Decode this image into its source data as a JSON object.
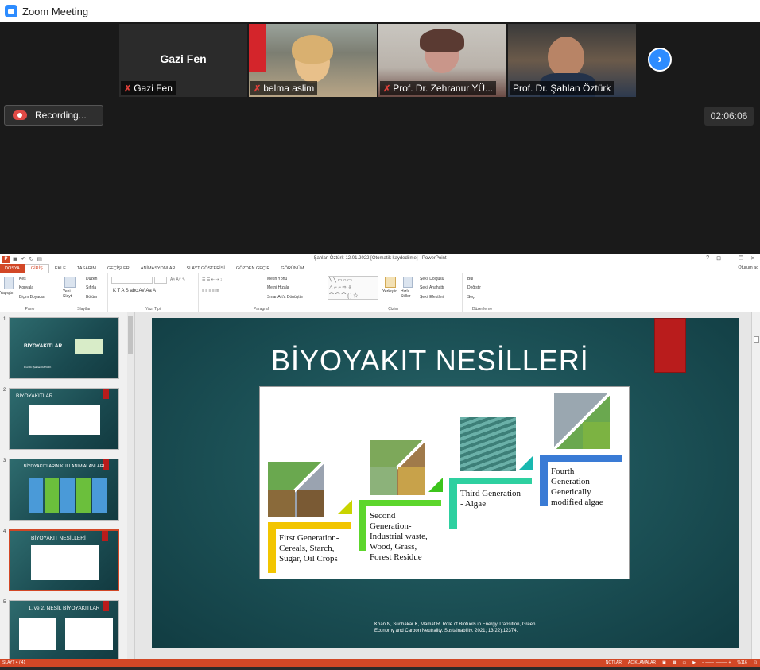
{
  "zoom": {
    "window_title": "Zoom Meeting",
    "participants": [
      {
        "name": "Gazi Fen",
        "display": "Gazi Fen",
        "video": false
      },
      {
        "name": "belma aslim",
        "video": true
      },
      {
        "name": "Prof. Dr. Zehranur YÜ...",
        "video": true
      },
      {
        "name": "Prof. Dr. Şahlan Öztürk",
        "video": true,
        "active": true
      }
    ],
    "recording_label": "Recording...",
    "timer": "02:06:06",
    "colors": {
      "accent": "#2D8CFF",
      "active_speaker": "#7ac943",
      "mute": "#e0403a"
    }
  },
  "ppt": {
    "logo": "P",
    "doc_title": "Şahlan Öztürk-12.01.2022 [Otomatik kaydedilme] - PowerPoint",
    "window_controls": [
      "?",
      "⊡",
      "–",
      "❐",
      "✕"
    ],
    "tabs": [
      "DOSYA",
      "GİRİŞ",
      "EKLE",
      "TASARIM",
      "GEÇİŞLER",
      "ANİMASYONLAR",
      "SLAYT GÖSTERİSİ",
      "GÖZDEN GEÇİR",
      "GÖRÜNÜM"
    ],
    "signin": "Oturum aç",
    "ribbon": {
      "paste": "Yapıştır",
      "cut": "Kes",
      "copy": "Kopyala",
      "format_painter": "Biçim Boyacısı",
      "group_pano": "Pano",
      "new_slide": "Yeni Slayt",
      "layout": "Düzen",
      "reset": "Sıfırla",
      "section": "Bölüm",
      "group_slaytlar": "Slaytlar",
      "group_yazi_tipi": "Yazı Tipi",
      "text_direction": "Metin Yönü",
      "align_text": "Metni Hizala",
      "smartart": "SmartArt'a Dönüştür",
      "group_paragraf": "Paragraf",
      "arrange": "Yerleştir",
      "quick_styles": "Hızlı Stiller",
      "shape_fill": "Şekil Dolgusu",
      "shape_outline": "Şekil Anahattı",
      "shape_effects": "Şekil Efektleri",
      "group_cizim": "Çizim",
      "find": "Bul",
      "replace": "Değiştir",
      "select": "Seç",
      "group_duzenleme": "Düzenleme"
    },
    "thumbnails": [
      {
        "num": "1",
        "title": "BİYOYAKITLAR",
        "subtitle": "Prof. Dr. Şahlan ÖZTÜRK"
      },
      {
        "num": "2",
        "title": "BİYOYAKITLAR"
      },
      {
        "num": "3",
        "title": "BİYOYAKITLARIN KULLANIM ALANLARI"
      },
      {
        "num": "4",
        "title": "BİYOYAKIT NESİLLERİ"
      },
      {
        "num": "5",
        "title": "1. ve 2. NESİL BİYOYAKITLAR"
      }
    ],
    "slide": {
      "title": "BİYOYAKIT NESİLLERİ",
      "steps": [
        {
          "label": "First Generation-\nCereals, Starch,\nSugar, Oil Crops",
          "color": "#f2c500"
        },
        {
          "label": "Second\nGeneration-\nIndustrial waste,\nWood, Grass,\nForest Residue",
          "color": "#5dd62c"
        },
        {
          "label": "Third Generation\n- Algae",
          "color": "#2ed0a0"
        },
        {
          "label": "Fourth\nGeneration –\nGenetically\nmodified algae",
          "color": "#3a7bd5"
        }
      ],
      "citation_line1": "Khan N, Sudhakar K, Mamat R. Role of Biofuels in Energy Transition, Green",
      "citation_line2": "Economy and Carbon Neutrality. Sustainability. 2021; 13(22):12374."
    },
    "status": {
      "slide_counter": "SLAYT 4 / 41",
      "notes": "NOTLAR",
      "comments": "AÇIKLAMALAR",
      "zoom": "%116"
    }
  }
}
